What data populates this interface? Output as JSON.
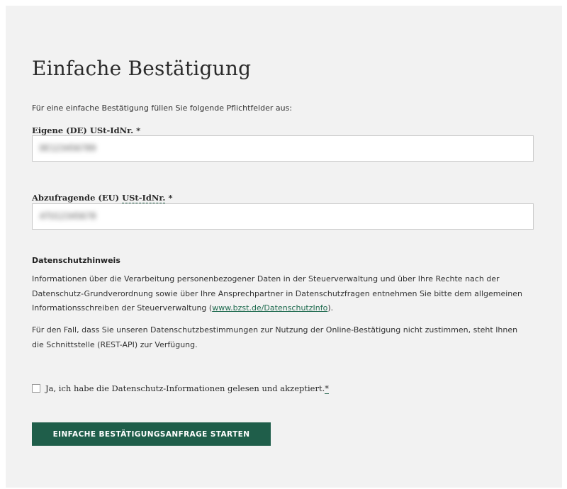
{
  "form": {
    "title": "Einfache Bestätigung",
    "intro": "Für eine einfache Bestätigung füllen Sie folgende Pflichtfelder aus:",
    "own_vat": {
      "label_prefix": "Eigene (DE) ",
      "label_abbr": "USt-IdNr.",
      "required_mark": " *",
      "value": "DE123456789"
    },
    "queried_vat": {
      "label_prefix": "Abzufragende (EU) ",
      "label_abbr": "USt-IdNr.",
      "required_mark": " *",
      "value": "ATU12345678"
    }
  },
  "privacy": {
    "heading": "Datenschutzhinweis",
    "para1_before_link": "Informationen über die Verarbeitung personenbezogener Daten in der Steuerverwaltung und über Ihre Rechte nach der Datenschutz-Grundverordnung sowie über Ihre Ansprechpartner in Datenschutzfragen entnehmen Sie bitte dem allgemeinen Informationsschreiben der Steuerverwaltung (",
    "para1_link": "www.bzst.de/DatenschutzInfo",
    "para1_after_link": ").",
    "para2": "Für den Fall, dass Sie unseren Datenschutzbestimmungen zur Nutzung der Online-Bestätigung nicht zustimmen, steht Ihnen die Schnittstelle (REST-API) zur Verfügung."
  },
  "consent": {
    "label": "Ja, ich habe die Datenschutz-Informationen gelesen und akzeptiert.",
    "required_mark": "*",
    "checked": false
  },
  "submit": {
    "label": "EINFACHE BESTÄTIGUNGSANFRAGE STARTEN"
  },
  "colors": {
    "primary": "#1f5e4a",
    "link": "#1f6b4f",
    "panel_bg": "#f2f2f2"
  }
}
